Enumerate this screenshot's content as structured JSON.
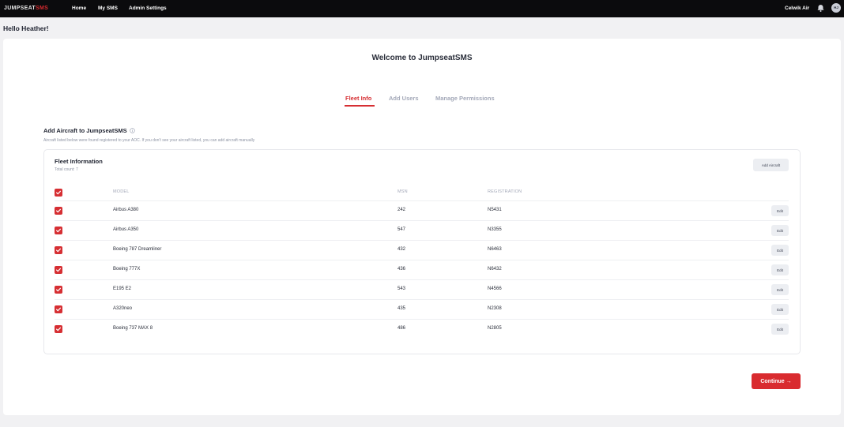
{
  "nav": {
    "logo_main": "JUMPSEAT",
    "logo_accent": "SMS",
    "links": [
      {
        "label": "Home"
      },
      {
        "label": "My SMS"
      },
      {
        "label": "Admin Settings"
      }
    ],
    "org_name": "Celwik Air",
    "avatar_initials": "HJ"
  },
  "greeting": "Hello Heather!",
  "welcome_title": "Welcome to JumpseatSMS",
  "tabs": [
    {
      "label": "Fleet Info",
      "active": true
    },
    {
      "label": "Add Users",
      "active": false
    },
    {
      "label": "Manage Permissions",
      "active": false
    }
  ],
  "section": {
    "title": "Add Aircraft to JumpseatSMS",
    "subtitle": "Aircraft listed below were found registered to your AOC. If you don't see your aircraft listed, you can add aircraft manually"
  },
  "fleet": {
    "title": "Fleet Information",
    "count_label": "Total count: 7",
    "add_button": "Add Aircraft",
    "columns": [
      "MODEL",
      "MSN",
      "REGISTRATION"
    ],
    "edit_label": "Edit",
    "rows": [
      {
        "model": "Airbus A380",
        "msn": "242",
        "registration": "N5431",
        "checked": true
      },
      {
        "model": "Airbus A350",
        "msn": "547",
        "registration": "N3355",
        "checked": true
      },
      {
        "model": "Boeing 787 Dreamliner",
        "msn": "432",
        "registration": "N6463",
        "checked": true
      },
      {
        "model": "Boeing 777X",
        "msn": "436",
        "registration": "N6432",
        "checked": true
      },
      {
        "model": "E195 E2",
        "msn": "543",
        "registration": "N4566",
        "checked": true
      },
      {
        "model": "A320neo",
        "msn": "435",
        "registration": "N2308",
        "checked": true
      },
      {
        "model": "Boeing 737 MAX 8",
        "msn": "486",
        "registration": "N2805",
        "checked": true
      }
    ]
  },
  "continue_label": "Continue →",
  "colors": {
    "accent": "#d62f33",
    "nav_bg": "#0b0b0d",
    "page_bg": "#f1f1f3"
  },
  "icons": [
    "bell-icon",
    "info-icon",
    "check-icon"
  ]
}
